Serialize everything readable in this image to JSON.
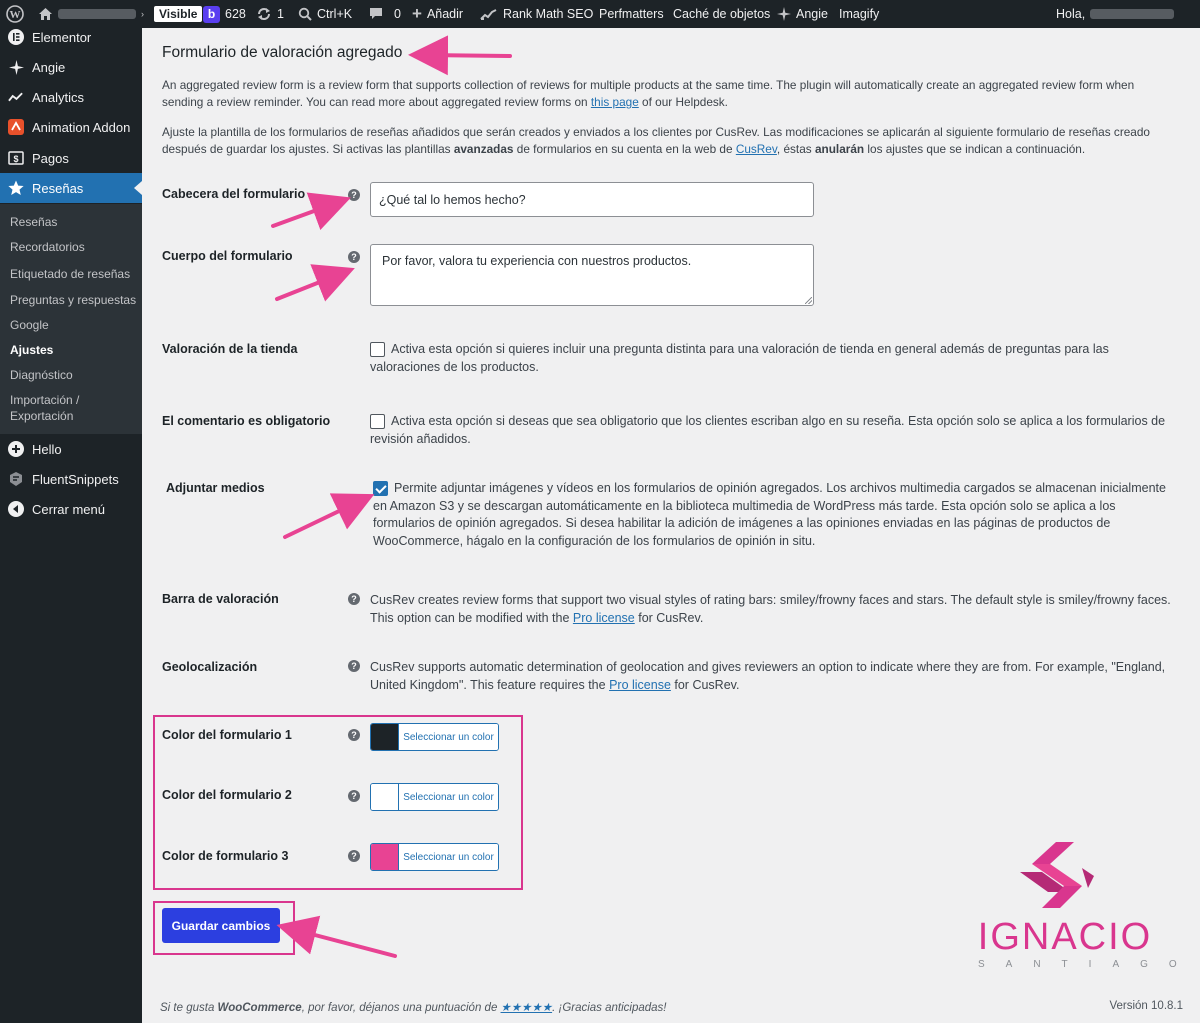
{
  "adminbar": {
    "visible_badge": "Visible",
    "b_count": "628",
    "updates_count": "1",
    "shortcut": "Ctrl+K",
    "comments_count": "0",
    "add_new": "Añadir",
    "rank_math": "Rank Math SEO",
    "perfmatters": "Perfmatters",
    "object_cache": "Caché de objetos",
    "angie": "Angie",
    "imagify": "Imagify",
    "greeting": "Hola,"
  },
  "sidebar": {
    "items": [
      {
        "label": "Elementor",
        "icon": "elementor-icon"
      },
      {
        "label": "Angie",
        "icon": "sparkle-icon"
      },
      {
        "label": "Analytics",
        "icon": "analytics-icon"
      },
      {
        "label": "Animation Addon",
        "icon": "animation-addon-icon"
      },
      {
        "label": "Pagos",
        "icon": "payments-icon"
      },
      {
        "label": "Reseñas",
        "icon": "star-icon"
      }
    ],
    "submenu": [
      "Reseñas",
      "Recordatorios",
      "Etiquetado de reseñas",
      "Preguntas y respuestas",
      "Google",
      "Ajustes",
      "Diagnóstico",
      "Importación / Exportación"
    ],
    "bottom_items": [
      {
        "label": "Hello",
        "icon": "plus-circle-icon"
      },
      {
        "label": "FluentSnippets",
        "icon": "fluent-icon"
      },
      {
        "label": "Cerrar menú",
        "icon": "collapse-icon"
      }
    ]
  },
  "page": {
    "title": "Formulario de valoración agregado",
    "intro1_a": "An aggregated review form is a review form that supports collection of reviews for multiple products at the same time. The plugin will automatically create an aggregated review form when sending a review reminder. You can read more about aggregated review forms on ",
    "intro1_link": "this page",
    "intro1_b": " of our Helpdesk.",
    "intro2_a": "Ajuste la plantilla de los formularios de reseñas añadidos que serán creados y enviados a los clientes por CusRev. Las modificaciones se aplicarán al siguiente formulario de reseñas creado después de guardar los ajustes. Si activas las plantillas ",
    "intro2_bold1": "avanzadas",
    "intro2_b": " de formularios en su cuenta en la web de ",
    "intro2_link": "CusRev",
    "intro2_c": ", éstas ",
    "intro2_bold2": "anularán",
    "intro2_d": " los ajustes que se indican a continuación."
  },
  "fields": {
    "header": {
      "label": "Cabecera del formulario",
      "value": "¿Qué tal lo hemos hecho?"
    },
    "body": {
      "label": "Cuerpo del formulario",
      "value": "Por favor, valora tu experiencia con nuestros productos."
    },
    "store_rating": {
      "label": "Valoración de la tienda",
      "text": "Activa esta opción si quieres incluir una pregunta distinta para una valoración de tienda en general además de preguntas para las valoraciones de los productos.",
      "checked": false
    },
    "comment_required": {
      "label": "El comentario es obligatorio",
      "text": "Activa esta opción si deseas que sea obligatorio que los clientes escriban algo en su reseña. Esta opción solo se aplica a los formularios de revisión añadidos.",
      "checked": false
    },
    "attach_media": {
      "label": "Adjuntar medios",
      "text": "Permite adjuntar imágenes y vídeos en los formularios de opinión agregados. Los archivos multimedia cargados se almacenan inicialmente en Amazon S3 y se descargan automáticamente en la biblioteca multimedia de WordPress más tarde. Esta opción solo se aplica a los formularios de opinión agregados. Si desea habilitar la adición de imágenes a las opiniones enviadas en las páginas de productos de WooCommerce, hágalo en la configuración de los formularios de opinión in situ.",
      "checked": true
    },
    "rating_bar": {
      "label": "Barra de valoración",
      "text_a": "CusRev creates review forms that support two visual styles of rating bars: smiley/frowny faces and stars. The default style is smiley/frowny faces. This option can be modified with the ",
      "link": "Pro license",
      "text_b": " for CusRev."
    },
    "geolocation": {
      "label": "Geolocalización",
      "text_a": "CusRev supports automatic determination of geolocation and gives reviewers an option to indicate where they are from. For example, \"England, United Kingdom\". This feature requires the ",
      "link": "Pro license",
      "text_b": " for CusRev."
    },
    "color1": {
      "label": "Color del formulario 1",
      "button": "Seleccionar un color",
      "color": "#1d2327"
    },
    "color2": {
      "label": "Color del formulario 2",
      "button": "Seleccionar un color",
      "color": "#ffffff"
    },
    "color3": {
      "label": "Color de formulario 3",
      "button": "Seleccionar un color",
      "color": "#e84393"
    }
  },
  "save_label": "Guardar cambios",
  "footer": {
    "left_a": "Si te gusta ",
    "left_bold": "WooCommerce",
    "left_b": ", por favor, déjanos una puntuación de ",
    "stars": "★★★★★",
    "left_c": ". ¡Gracias anticipadas!",
    "version": "Versión 10.8.1"
  },
  "watermark": {
    "name": "IGNACIO",
    "sub": "SANTIAGO"
  },
  "colors": {
    "accent": "#2271b1",
    "annotation": "#d9368e",
    "save_button": "#2c3fe0"
  }
}
